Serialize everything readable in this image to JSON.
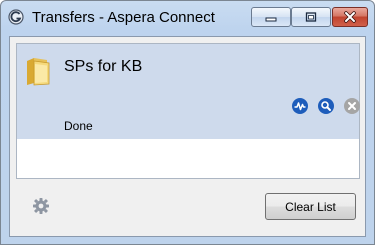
{
  "window": {
    "title": "Transfers - Aspera Connect",
    "icon": "aspera-connect-icon",
    "controls": [
      "minimize-icon",
      "maximize-icon",
      "close-icon"
    ]
  },
  "transfers": [
    {
      "name": "SPs for KB",
      "status": "Done",
      "icon": "folder-icon",
      "actions": [
        "activity-graph-icon",
        "reveal-search-icon",
        "remove-icon"
      ]
    }
  ],
  "footer": {
    "settings_icon": "gear-icon",
    "clear_label": "Clear List"
  },
  "colors": {
    "selected_row": "#cedaec",
    "action_blue": "#1e5dbb",
    "close_red": "#c0432e"
  }
}
